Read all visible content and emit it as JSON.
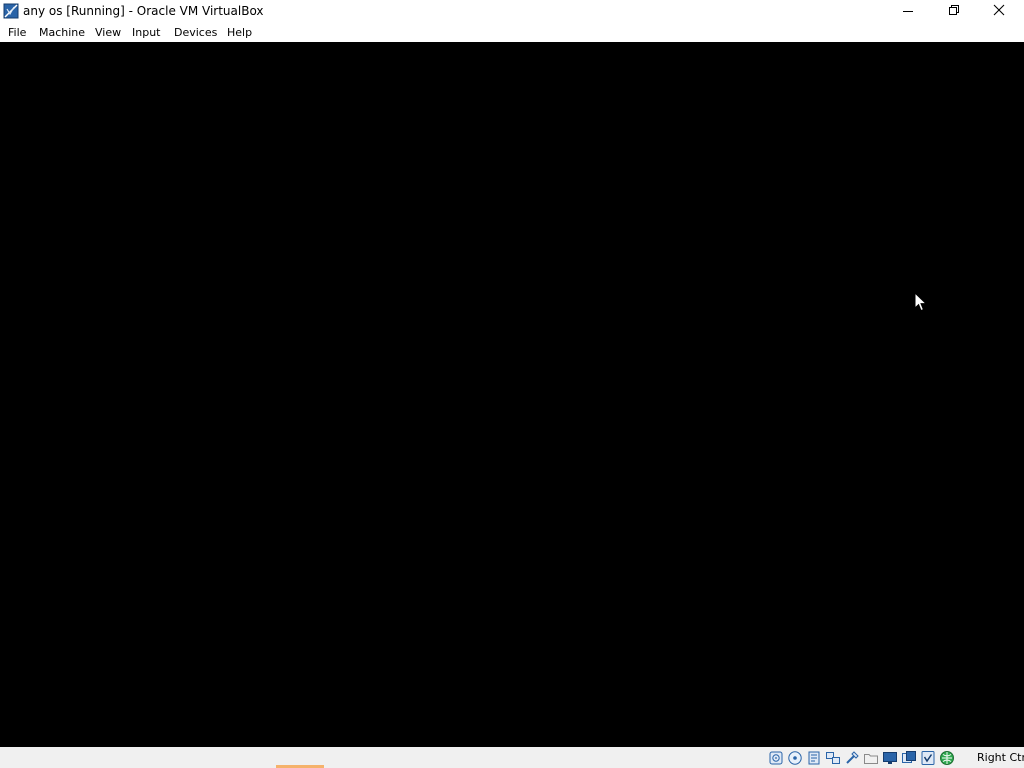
{
  "window": {
    "title": "any os [Running] - Oracle VM VirtualBox",
    "app_icon": "virtualbox-icon",
    "controls": [
      "minimize-icon",
      "restore-icon",
      "close-icon"
    ]
  },
  "menubar": {
    "items": [
      {
        "label": "File"
      },
      {
        "label": "Machine"
      },
      {
        "label": "View"
      },
      {
        "label": "Input"
      },
      {
        "label": "Devices"
      },
      {
        "label": "Help"
      }
    ]
  },
  "vm_screen": {
    "background": "#000000",
    "pointer_icon": "mouse-pointer-icon"
  },
  "statusbar": {
    "host_key": "Right Ctrl",
    "icons": [
      "hard-disk-icon",
      "optical-drive-icon",
      "audio-icon",
      "network-icon",
      "usb-icon",
      "shared-folders-icon",
      "display-icon",
      "video-capture-icon",
      "mouse-integration-icon",
      "keyboard-capture-icon"
    ]
  }
}
